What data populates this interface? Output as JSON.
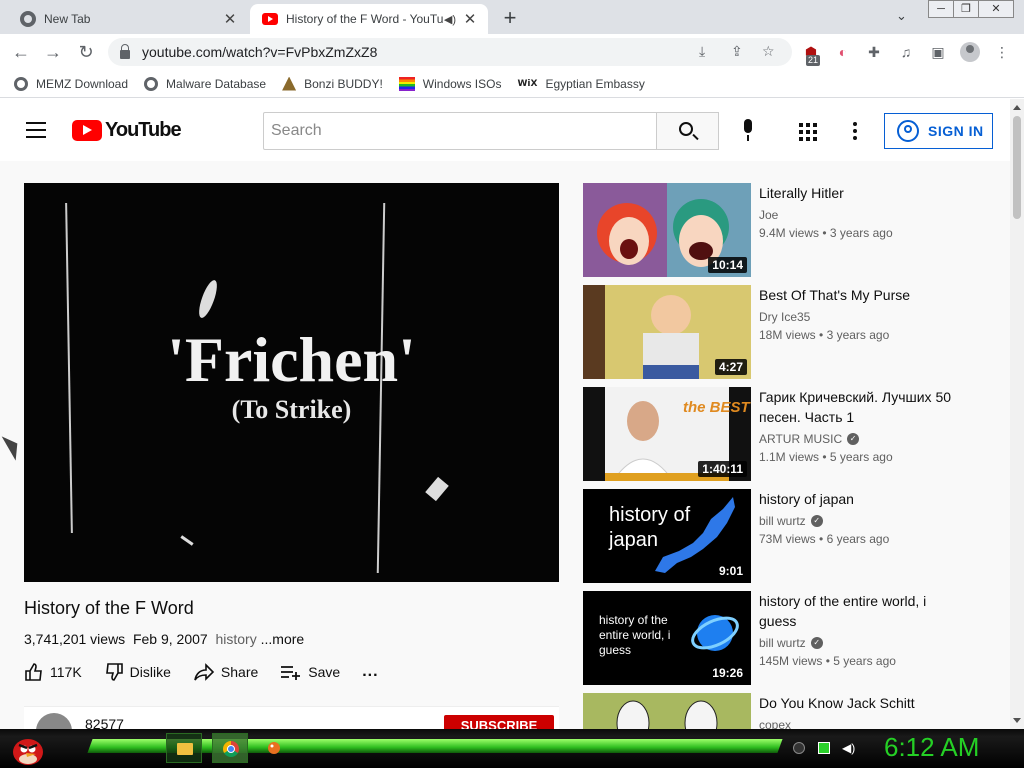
{
  "browser": {
    "tabs": [
      {
        "title": "New Tab"
      },
      {
        "title": "History of the F Word - YouTube"
      }
    ],
    "close_glyph": "✕",
    "new_tab_glyph": "+",
    "url": "youtube.com/watch?v=FvPbxZmZxZ8",
    "extension_badge": "21",
    "window_controls": [
      "─",
      "❐",
      "✕"
    ]
  },
  "bookmarks": [
    {
      "label": "MEMZ Download",
      "icon": "globe-icon"
    },
    {
      "label": "Malware Database",
      "icon": "globe-icon"
    },
    {
      "label": "Bonzi BUDDY!",
      "icon": "bonzi-icon"
    },
    {
      "label": "Windows ISOs",
      "icon": "windows-icon"
    },
    {
      "label": "Egyptian Embassy",
      "icon": "wix-icon",
      "icon_text": "WiX"
    }
  ],
  "youtube": {
    "logo_text": "YouTube",
    "search_placeholder": "Search",
    "sign_in_label": "SIGN IN",
    "accent": "#065fd4",
    "brand_red": "#ff0000"
  },
  "video": {
    "frame_title": "'Frichen'",
    "frame_subtitle": "(To Strike)",
    "title": "History of the F Word",
    "views": "3,741,201 views",
    "date": "Feb 9, 2007",
    "tag": "history",
    "more_label": "...more",
    "likes": "117K",
    "dislike_label": "Dislike",
    "share_label": "Share",
    "save_label": "Save",
    "more_actions": "...",
    "channel_name": "82577",
    "subscribe_label": "SUBSCRIBE"
  },
  "recommendations": [
    {
      "title": "Literally Hitler",
      "channel": "Joe",
      "verified": false,
      "views": "9.4M views",
      "age": "3 years ago",
      "duration": "10:14"
    },
    {
      "title": "Best Of That's My Purse",
      "channel": "Dry Ice35",
      "verified": false,
      "views": "18M views",
      "age": "3 years ago",
      "duration": "4:27"
    },
    {
      "title": "Гарик Кричевский. Лучших 50 песен. Часть 1",
      "channel": "ARTUR MUSIC",
      "verified": true,
      "views": "1.1M views",
      "age": "5 years ago",
      "duration": "1:40:11",
      "thumb_text": "the BEST"
    },
    {
      "title": "history of japan",
      "channel": "bill wurtz",
      "verified": true,
      "views": "73M views",
      "age": "6 years ago",
      "duration": "9:01",
      "thumb_text": "history of japan"
    },
    {
      "title": "history of the entire world, i guess",
      "channel": "bill wurtz",
      "verified": true,
      "views": "145M views",
      "age": "5 years ago",
      "duration": "19:26",
      "thumb_text": "history of the entire world, i guess"
    },
    {
      "title": "Do You Know Jack Schitt",
      "channel": "copex",
      "verified": false,
      "views": "",
      "age": "",
      "duration": ""
    }
  ],
  "taskbar": {
    "clock": "6:12 AM",
    "accent": "#25d025"
  }
}
